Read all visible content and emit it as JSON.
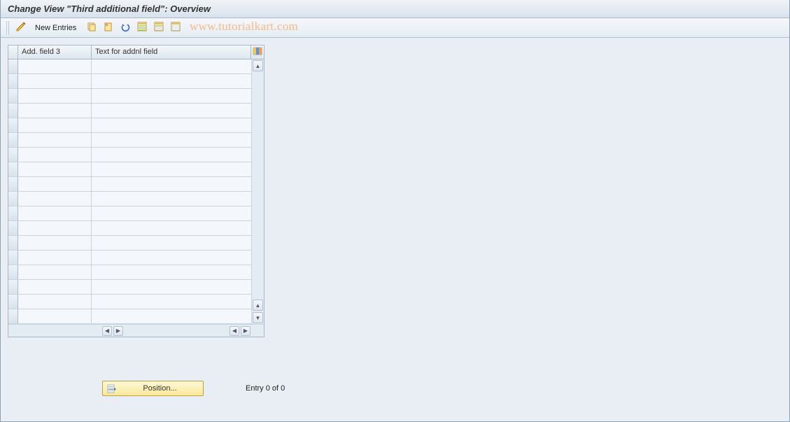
{
  "title": "Change View \"Third additional field\": Overview",
  "toolbar": {
    "new_entries_label": "New Entries"
  },
  "watermark": "www.tutorialkart.com",
  "table": {
    "columns": {
      "col1": "Add. field 3",
      "col2": "Text for addnl field"
    },
    "rows": [
      {
        "c1": "",
        "c2": ""
      },
      {
        "c1": "",
        "c2": ""
      },
      {
        "c1": "",
        "c2": ""
      },
      {
        "c1": "",
        "c2": ""
      },
      {
        "c1": "",
        "c2": ""
      },
      {
        "c1": "",
        "c2": ""
      },
      {
        "c1": "",
        "c2": ""
      },
      {
        "c1": "",
        "c2": ""
      },
      {
        "c1": "",
        "c2": ""
      },
      {
        "c1": "",
        "c2": ""
      },
      {
        "c1": "",
        "c2": ""
      },
      {
        "c1": "",
        "c2": ""
      },
      {
        "c1": "",
        "c2": ""
      },
      {
        "c1": "",
        "c2": ""
      },
      {
        "c1": "",
        "c2": ""
      },
      {
        "c1": "",
        "c2": ""
      },
      {
        "c1": "",
        "c2": ""
      },
      {
        "c1": "",
        "c2": ""
      }
    ]
  },
  "footer": {
    "position_label": "Position...",
    "entry_text": "Entry 0 of 0"
  }
}
